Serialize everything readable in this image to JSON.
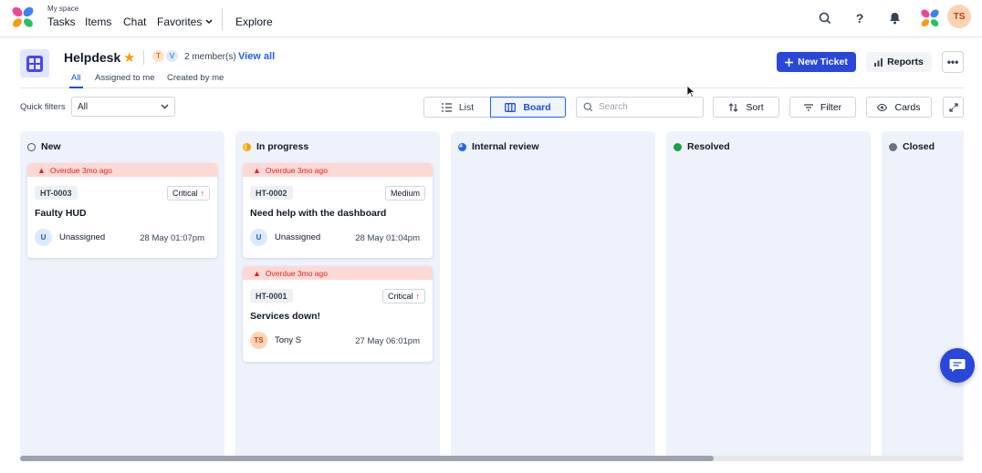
{
  "topnav": {
    "space_label": "My space",
    "items": [
      "Tasks",
      "Items",
      "Chat",
      "Favorites",
      "Explore"
    ],
    "avatar_initials": "TS"
  },
  "header": {
    "title": "Helpdesk",
    "member_initials": [
      "T",
      "V"
    ],
    "members_count": "2 member(s)",
    "view_all": "View all",
    "new_ticket": "New Ticket",
    "reports": "Reports"
  },
  "tabs": [
    "All",
    "Assigned to me",
    "Created by me"
  ],
  "filters": {
    "quick_filters_label": "Quick filters",
    "quick_filters_value": "All",
    "view_list": "List",
    "view_board": "Board",
    "search_placeholder": "Search",
    "sort": "Sort",
    "filter": "Filter",
    "cards": "Cards"
  },
  "columns": [
    {
      "name": "New",
      "status_color": "#4b5563"
    },
    {
      "name": "In progress",
      "status_color": "#f59e0b"
    },
    {
      "name": "Internal review",
      "status_color": "#2563eb"
    },
    {
      "name": "Resolved",
      "status_color": "#16a34a"
    },
    {
      "name": "Closed",
      "status_color": "#6b7280"
    }
  ],
  "cards": [
    {
      "column": "New",
      "alert": "Overdue 3mo ago",
      "id": "HT-0003",
      "priority": "Critical",
      "title": "Faulty HUD",
      "assignee_initials": "U",
      "assignee": "Unassigned",
      "date": "28 May 01:07pm"
    },
    {
      "column": "In progress",
      "alert": "Overdue 3mo ago",
      "id": "HT-0002",
      "priority": "Medium",
      "title": "Need help with the dashboard",
      "assignee_initials": "U",
      "assignee": "Unassigned",
      "date": "28 May 01:04pm"
    },
    {
      "column": "In progress",
      "alert": "Overdue 3mo ago",
      "id": "HT-0001",
      "priority": "Critical",
      "title": "Services down!",
      "assignee_initials": "TS",
      "assignee": "Tony S",
      "date": "27 May 06:01pm"
    }
  ],
  "colors": {
    "primary": "#2948d9",
    "overdue_bg": "#fdd9d5",
    "overdue_text": "#dc2626",
    "column_bg": "#eef2fb"
  }
}
